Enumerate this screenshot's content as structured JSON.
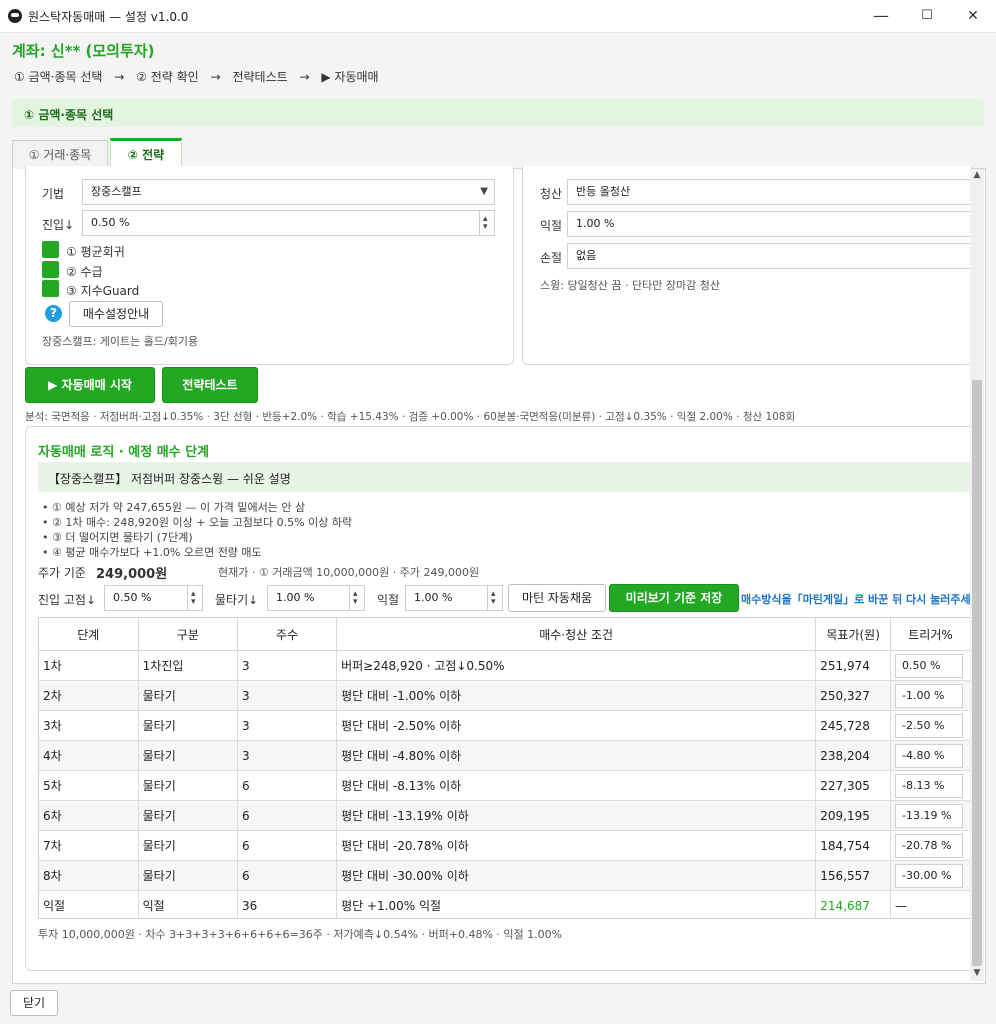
{
  "window": {
    "title": "원스탁자동매매 — 설정 v1.0.0",
    "minimize": "—",
    "maximize": "☐",
    "close": "✕"
  },
  "header": {
    "account": "계좌: 신** (모의투자)",
    "steps": [
      "① 금액·종목 선택",
      "→",
      "② 전략 확인",
      "→",
      "전략테스트",
      "→",
      "▶ 자동매매"
    ]
  },
  "section": {
    "title": "① 금액·종목 선택"
  },
  "tabs": [
    {
      "label": "① 거래·종목"
    },
    {
      "label": "② 전략"
    }
  ],
  "left_card": {
    "technique_label": "기법",
    "technique_value": "장중스캘프",
    "entry_label": "진입↓",
    "entry_value": "0.50 %",
    "checks": [
      "① 평균회귀",
      "② 수급",
      "③ 지수Guard"
    ],
    "help_button": "매수설정안내",
    "note": "장중스캘프: 게이트는 홀드/회기용"
  },
  "right_card": {
    "settle_label": "청산",
    "settle_value": "반등 올청산",
    "profit_label": "익절",
    "profit_value": "1.00 %",
    "stop_label": "손절",
    "stop_value": "없음",
    "note": "스윙: 당일청산 끔 · 단타만 장마감 청산"
  },
  "actions": {
    "start": "▶ 자동매매 시작",
    "test": "전략테스트"
  },
  "analysis": "분석: 국면적응 · 저점버퍼·고점↓0.35% · 3단 선형 · 반등+2.0% · 학습 +15.43% · 검증 +0.00% · 60분봉·국면적응(미분류) · 고점↓0.35% · 익절 2.00% · 청산 108회",
  "logic": {
    "title": "자동매매 로직 · 예정 매수 단계",
    "summary": "【장중스캘프】 저점버퍼 장중스윙 — 쉬운 설명",
    "bullets": [
      "• ① 예상 저가 약 247,655원 — 이 가격 밑에서는 안 삼",
      "• ② 1차 매수: 248,920원 이상 + 오늘 고점보다 0.5% 이상 하락",
      "• ③ 더 떨어지면 물타기 (7단계)",
      "• ④ 평균 매수가보다 +1.0% 오르면 전량 매도"
    ],
    "price_label": "주가 기준",
    "price_value": "249,000원",
    "current_info": "현재가 · ① 거래금액 10,000,000원 · 주가 249,000원"
  },
  "controls": {
    "entry_label": "진입 고점↓",
    "entry_value": "0.50 %",
    "water_label": "물타기↓",
    "water_value": "1.00 %",
    "profit_label": "익절",
    "profit_value": "1.00 %",
    "martin_button": "마틴 자동채움",
    "preview_button": "미리보기 기준 저장",
    "hint": "매수방식을「마틴게일」로 바꾼 뒤 다시 눌러주세요"
  },
  "table": {
    "headers": [
      "단계",
      "구분",
      "주수",
      "매수·청산 조건",
      "목표가(원)",
      "트리거%"
    ],
    "rows": [
      [
        "1차",
        "1차진입",
        "3",
        "버퍼≥248,920 · 고점↓0.50%",
        "251,974",
        "0.50 %"
      ],
      [
        "2차",
        "물타기",
        "3",
        "평단 대비 -1.00% 이하",
        "250,327",
        "-1.00 %"
      ],
      [
        "3차",
        "물타기",
        "3",
        "평단 대비 -2.50% 이하",
        "245,728",
        "-2.50 %"
      ],
      [
        "4차",
        "물타기",
        "3",
        "평단 대비 -4.80% 이하",
        "238,204",
        "-4.80 %"
      ],
      [
        "5차",
        "물타기",
        "6",
        "평단 대비 -8.13% 이하",
        "227,305",
        "-8.13 %"
      ],
      [
        "6차",
        "물타기",
        "6",
        "평단 대비 -13.19% 이하",
        "209,195",
        "-13.19 %"
      ],
      [
        "7차",
        "물타기",
        "6",
        "평단 대비 -20.78% 이하",
        "184,754",
        "-20.78 %"
      ],
      [
        "8차",
        "물타기",
        "6",
        "평단 대비 -30.00% 이하",
        "156,557",
        "-30.00 %"
      ],
      [
        "익절",
        "익절",
        "36",
        "평단 +1.00% 익절",
        "214,687",
        "—"
      ]
    ]
  },
  "footer": {
    "summary": "투자 10,000,000원 · 차수 3+3+3+3+6+6+6+6=36주 · 저가예측↓0.54% · 버퍼+0.48% · 익절 1.00%",
    "close_button": "닫기"
  },
  "colors": {
    "accent": "#23a823",
    "accent_text": "#21a621",
    "link": "#1a73c9"
  }
}
